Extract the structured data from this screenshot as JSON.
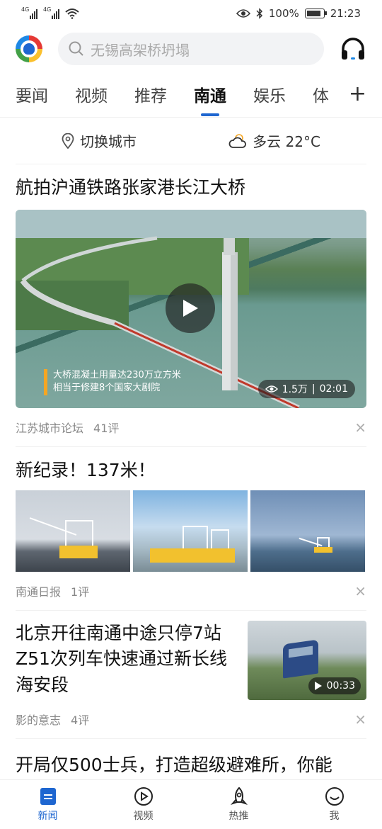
{
  "status_bar": {
    "sig1_label": "4G",
    "sig2_label": "4G",
    "battery": "100%",
    "time": "21:23"
  },
  "header": {
    "search_placeholder": "无锡高架桥坍塌"
  },
  "tabs": [
    {
      "label": "要闻"
    },
    {
      "label": "视频"
    },
    {
      "label": "推荐"
    },
    {
      "label": "南通"
    },
    {
      "label": "娱乐"
    },
    {
      "label": "体"
    }
  ],
  "tabs_more": "+",
  "city_bar": {
    "switch_city": "切换城市",
    "weather": "多云 22°C"
  },
  "articles": [
    {
      "title": "航拍沪通铁路张家港长江大桥",
      "caption_line1": "大桥混凝土用量达230万立方米",
      "caption_line2": "相当于修建8个国家大剧院",
      "views": "1.5万",
      "duration": "02:01",
      "source": "江苏城市论坛",
      "comments": "41评"
    },
    {
      "title": "新纪录！137米！",
      "source": "南通日报",
      "comments": "1评"
    },
    {
      "title": "北京开往南通中途只停7站 Z51次列车快速通过新长线海安段",
      "duration": "00:33",
      "source": "影的意志",
      "comments": "4评"
    },
    {
      "title": "开局仅500士兵，打造超级避难所，你能"
    }
  ],
  "close_label": "×",
  "bottom_nav": [
    {
      "label": "新闻"
    },
    {
      "label": "视频"
    },
    {
      "label": "热推"
    },
    {
      "label": "我"
    }
  ],
  "colors": {
    "accent": "#1e66d0",
    "caption_bar": "#f5a623"
  }
}
